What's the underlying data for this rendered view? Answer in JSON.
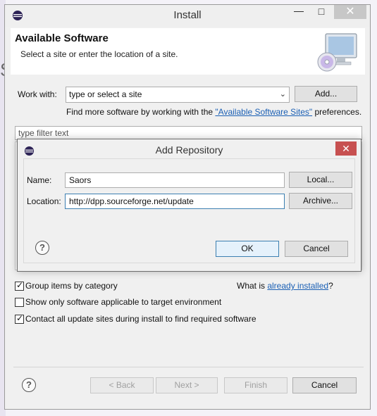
{
  "window": {
    "title": "Install",
    "min_icon": "—",
    "max_icon": "□",
    "close_icon": "✕"
  },
  "header": {
    "title": "Available Software",
    "subtitle": "Select a site or enter the location of a site."
  },
  "work_with": {
    "label": "Work with:",
    "value": "type or select a site",
    "add_button": "Add...",
    "more_prefix": "Find more software by working with the ",
    "more_link": "\"Available Software Sites\"",
    "more_suffix": " preferences."
  },
  "filter": {
    "placeholder": "type filter text"
  },
  "options": {
    "group_by_category": {
      "label": "Group items by category",
      "checked": true
    },
    "what_is_prefix": "What is ",
    "already_installed_link": "already installed",
    "what_is_suffix": "?",
    "show_only_applicable": {
      "label": "Show only software applicable to target environment",
      "checked": false
    },
    "contact_all_sites": {
      "label": "Contact all update sites during install to find required software",
      "checked": true
    }
  },
  "footer": {
    "back_button": "< Back",
    "next_button": "Next >",
    "finish_button": "Finish",
    "cancel_button": "Cancel"
  },
  "dialog": {
    "title": "Add Repository",
    "close_icon": "✕",
    "name_label": "Name:",
    "name_value": "Saors",
    "local_button": "Local...",
    "location_label": "Location:",
    "location_value": "http://dpp.sourceforge.net/update",
    "archive_button": "Archive...",
    "ok_button": "OK",
    "cancel_button": "Cancel"
  },
  "background": {
    "partial_letter": "S"
  }
}
